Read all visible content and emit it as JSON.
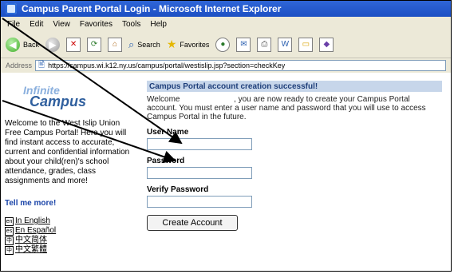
{
  "window": {
    "title": "Campus Parent Portal Login - Microsoft Internet Explorer"
  },
  "menubar": {
    "items": [
      "File",
      "Edit",
      "View",
      "Favorites",
      "Tools",
      "Help"
    ]
  },
  "toolbar": {
    "back_label": "Back",
    "search_label": "Search",
    "favorites_label": "Favorites"
  },
  "address": {
    "label": "Address",
    "url": "https://campus.wi.k12.ny.us/campus/portal/westislip.jsp?section=checkKey"
  },
  "sidebar": {
    "logo_line1": "Infinite",
    "logo_line2": "Campus",
    "intro": "Welcome to the West Islip Union Free Campus Portal! Here you will find instant access to accurate, current and confidential information about your child(ren)'s school attendance, grades, class assignments and more!",
    "tell_more": "Tell me more!",
    "languages": [
      "In English",
      "En Español",
      "中文简体",
      "中文繁體"
    ]
  },
  "content": {
    "banner": "Campus Portal account creation successful!",
    "message_parts": [
      "Welcome",
      ", you are now ready to create your Campus Portal account. You must enter a user name and password that you will use to access Campus Portal in the future."
    ],
    "username_label": "User Name",
    "password_label": "Password",
    "verify_label": "Verify Password",
    "button_label": "Create Account"
  },
  "colors": {
    "titlebar": "#2f66d8",
    "banner": "#c7d6ea",
    "link": "#1a44a8"
  }
}
